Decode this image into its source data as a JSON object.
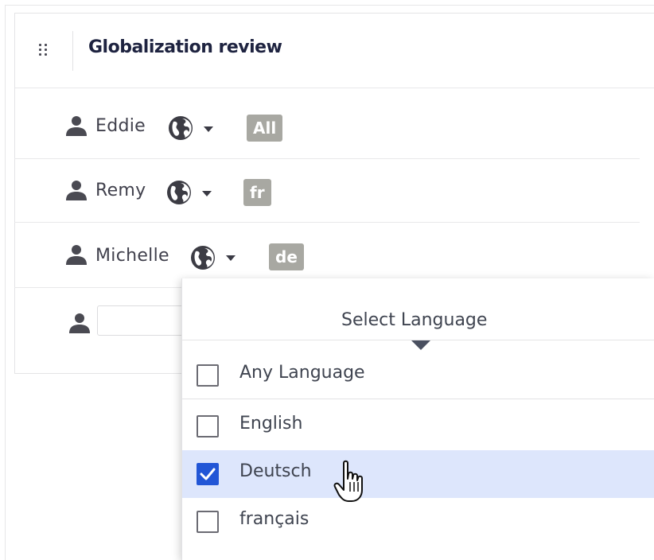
{
  "panel": {
    "title": "Globalization review"
  },
  "reviewers": [
    {
      "name": "Eddie",
      "language_badge": "All"
    },
    {
      "name": "Remy",
      "language_badge": "fr"
    },
    {
      "name": "Michelle",
      "language_badge": "de"
    }
  ],
  "new_reviewer": {
    "input_value": "",
    "placeholder": ""
  },
  "language_dropdown": {
    "title": "Select Language",
    "options": [
      {
        "label": "Any Language",
        "checked": false
      },
      {
        "label": "English",
        "checked": false
      },
      {
        "label": "Deutsch",
        "checked": true
      },
      {
        "label": "français",
        "checked": false
      }
    ]
  },
  "icons": {
    "drag": "drag-handle-icon",
    "user": "user-icon",
    "globe": "globe-icon",
    "caret": "chevron-down-icon",
    "check": "check-icon",
    "cursor": "hand-pointer-icon"
  },
  "colors": {
    "title": "#1e2340",
    "badge": "#a8a8a2",
    "selected_row": "#dde6fc",
    "checkbox_checked": "#2256d6"
  }
}
